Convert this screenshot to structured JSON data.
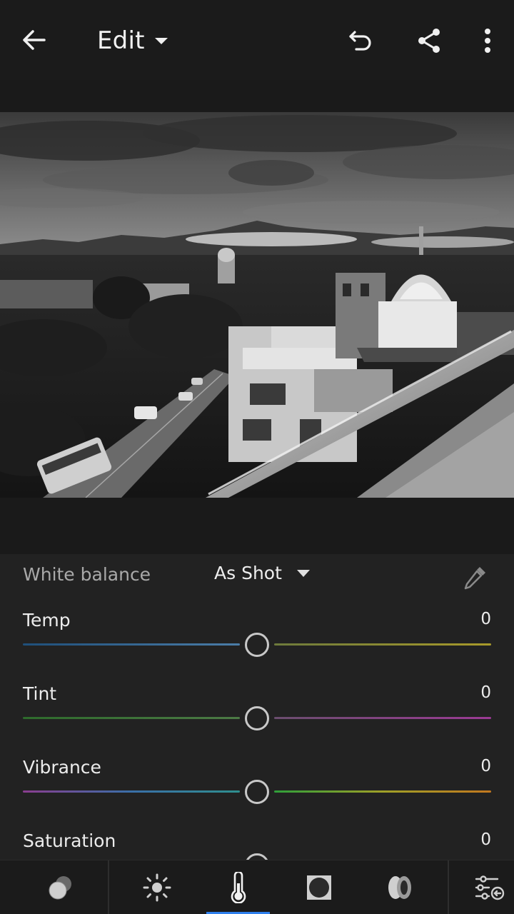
{
  "header": {
    "title": "Edit",
    "icons": [
      "back-arrow-icon",
      "dropdown-caret-icon",
      "undo-icon",
      "share-icon",
      "more-vertical-icon"
    ]
  },
  "white_balance": {
    "label": "White balance",
    "value": "As Shot",
    "icons": [
      "dropdown-caret-icon",
      "eyedropper-icon"
    ]
  },
  "sliders": [
    {
      "label": "Temp",
      "value": "0",
      "level": 0.5,
      "left_colors": [
        "#1f4f7a",
        "#4b7da8"
      ],
      "right_colors": [
        "#6d7a3c",
        "#a89a2a"
      ]
    },
    {
      "label": "Tint",
      "value": "0",
      "level": 0.5,
      "left_colors": [
        "#2e6b2c",
        "#4c7a45"
      ],
      "right_colors": [
        "#6a4d6e",
        "#9b3a94"
      ]
    },
    {
      "label": "Vibrance",
      "value": "0",
      "level": 0.5,
      "left_colors": [
        "#8a3d8f",
        "#3a6fa8",
        "#2f8f8f"
      ],
      "right_colors": [
        "#2f9f3a",
        "#9fa028",
        "#c2781f"
      ]
    },
    {
      "label": "Saturation",
      "value": "0",
      "level": 0.5,
      "left_colors": [
        "#444444",
        "#555555"
      ],
      "right_colors": [
        "#555555",
        "#666666"
      ]
    }
  ],
  "toolbar": {
    "tools": [
      "presets-icon",
      "light-icon",
      "color-temperature-icon",
      "vignette-icon",
      "optics-icon",
      "adjustments-icon"
    ],
    "active": "color-temperature-icon",
    "accent": "#2f80ed"
  }
}
